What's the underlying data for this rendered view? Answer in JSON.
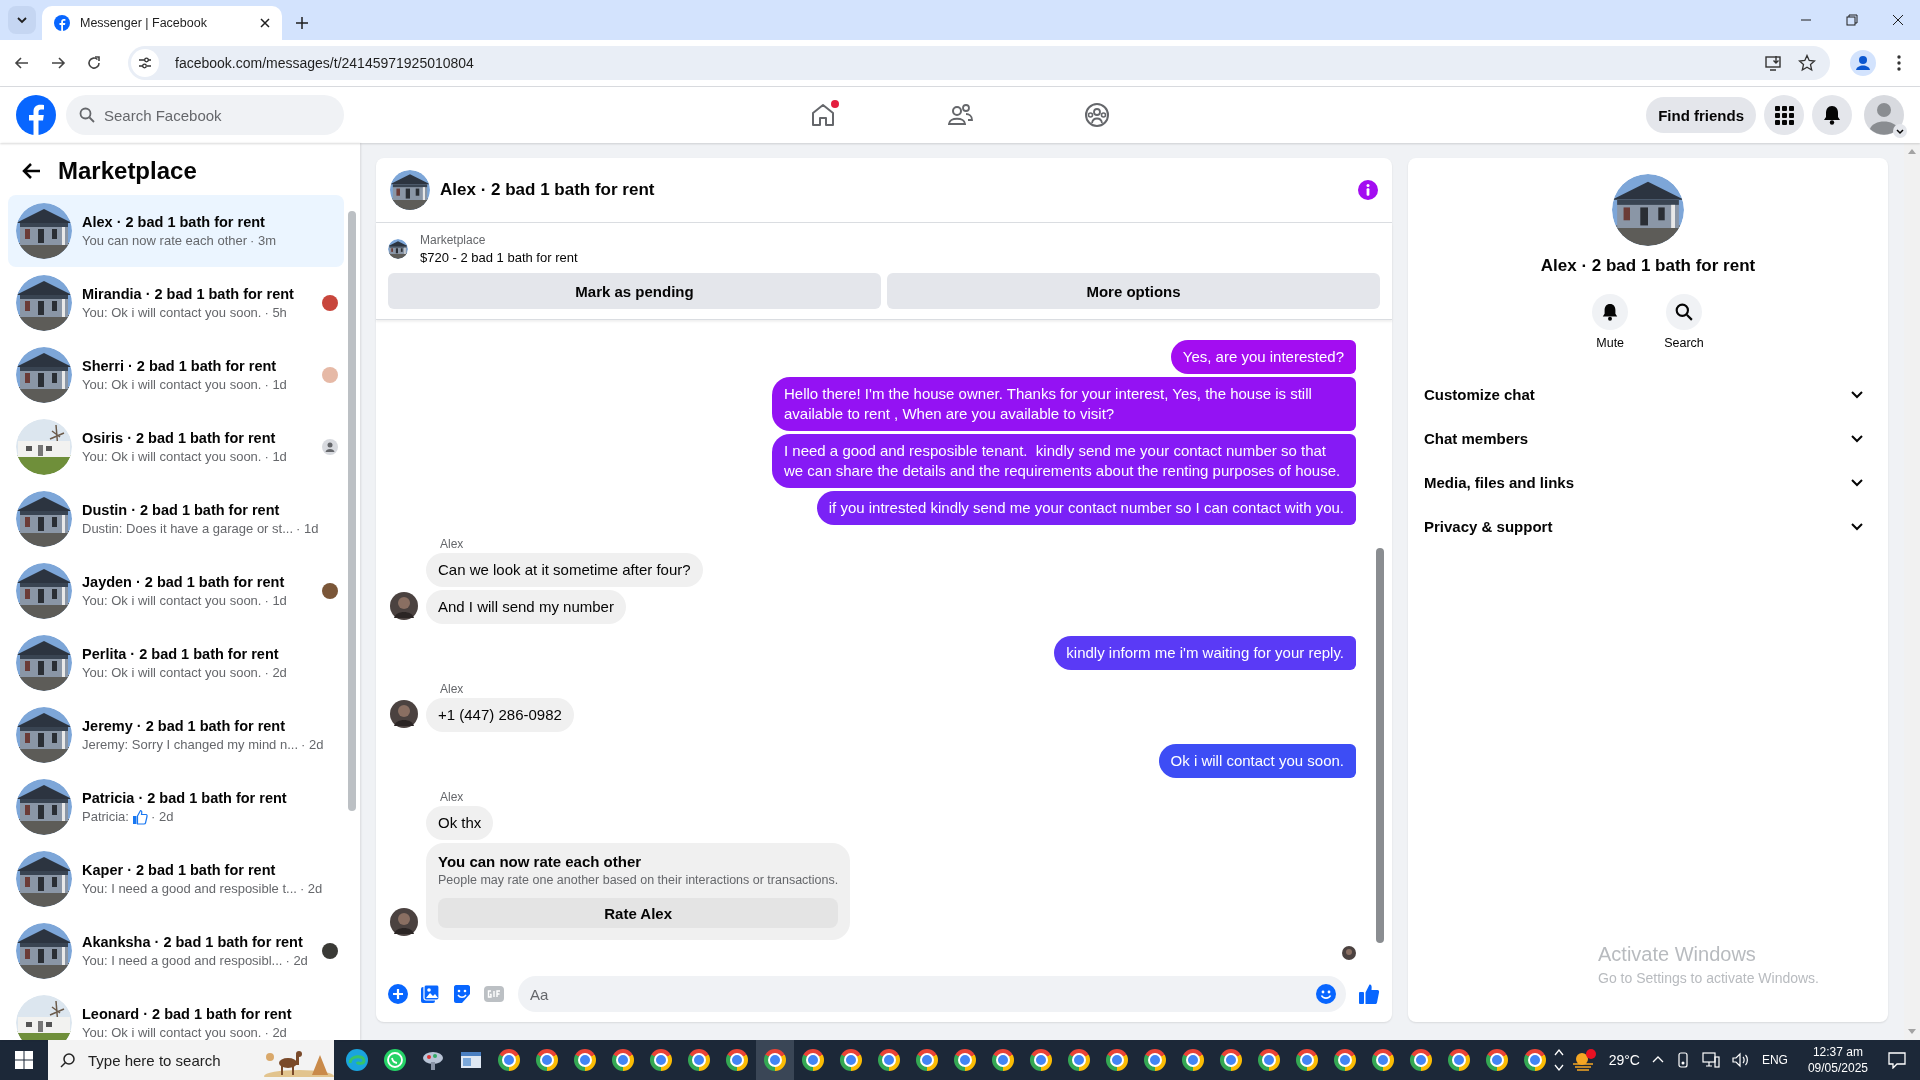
{
  "browser": {
    "tab": {
      "title": "Messenger | Facebook"
    },
    "url": "facebook.com/messages/t/24145971925010804"
  },
  "header": {
    "search": {
      "placeholder": "Search Facebook"
    },
    "nav": [
      {
        "kind": "home",
        "badge": true
      },
      {
        "kind": "friends",
        "badge": false
      },
      {
        "kind": "groups",
        "badge": false
      }
    ],
    "find_friends": "Find friends"
  },
  "sidebar": {
    "title": "Marketplace",
    "conversations": [
      {
        "name": "Alex · 2 bad 1 bath for rent",
        "preview": "You can now rate each other",
        "time": "· 3m",
        "kind": "house",
        "selected": true
      },
      {
        "name": "Mirandia · 2 bad 1 bath for rent",
        "preview": "You: Ok i will contact you soon.",
        "time": "· 5h",
        "kind": "house",
        "selected": false
      },
      {
        "name": "Sherri · 2 bad 1 bath for rent",
        "preview": "You: Ok i will contact you soon.",
        "time": "· 1d",
        "kind": "house",
        "selected": false
      },
      {
        "name": "Osiris · 2 bad 1 bath for rent",
        "preview": "You: Ok i will contact you soon.",
        "time": "· 1d",
        "kind": "cottage",
        "selected": false,
        "seen": {
          "kind": "default",
          "color": "#d8dadf"
        }
      },
      {
        "name": "Dustin · 2 bad 1 bath for rent",
        "preview": "Dustin: Does it have a garage or st...",
        "time": "· 1d",
        "kind": "house",
        "selected": false
      },
      {
        "name": "Jayden · 2 bad 1 bath for rent",
        "preview": "You: Ok i will contact you soon.",
        "time": "· 1d",
        "kind": "house",
        "selected": false
      },
      {
        "name": "Perlita · 2 bad 1 bath for rent",
        "preview": "You: Ok i will contact you soon.",
        "time": "· 2d",
        "kind": "house",
        "selected": false
      },
      {
        "name": "Jeremy · 2 bad 1 bath for rent",
        "preview": "Jeremy: Sorry I changed my mind n...",
        "time": "· 2d",
        "kind": "house",
        "selected": false
      },
      {
        "name": "Patricia · 2 bad 1 bath for rent",
        "preview": "Patricia:",
        "liked": true,
        "time": "· 2d",
        "kind": "house",
        "selected": false
      },
      {
        "name": "Kaper · 2 bad 1 bath for rent",
        "preview": "You: I need a good and resposible t...",
        "time": "· 2d",
        "kind": "house",
        "selected": false
      },
      {
        "name": "Akanksha · 2 bad 1 bath for rent",
        "preview": "You: I need a good and resposibl...",
        "time": "· 2d",
        "kind": "house",
        "selected": false
      },
      {
        "name": "Leonard · 2 bad 1 bath for rent",
        "preview": "You: Ok i will contact you soon.",
        "time": "· 2d",
        "kind": "cottage",
        "selected": false
      }
    ]
  },
  "chat": {
    "title": "Alex · 2 bad 1 bath for rent",
    "listing": {
      "label": "Marketplace",
      "price": "$720 - 2 bad 1 bath for rent"
    },
    "actions": [
      "Mark as pending",
      "More options"
    ],
    "messages": [
      {
        "kind": "out",
        "text": "Yes, are you interested?",
        "color": "#a30df1"
      },
      {
        "kind": "out",
        "text": "Hello there! I'm the house owner. Thanks for your interest, Yes, the house is still available to rent , When are you available to visit?",
        "color": "#9412f3"
      },
      {
        "kind": "out",
        "text": "I need a good and resposible tenant.  kindly send me your contact number so that we can share the details and the requirements about the renting purposes of house.",
        "color": "#861af5"
      },
      {
        "kind": "out",
        "text": "if you intrested kindly send me your contact number so I can contact with you.",
        "color": "#7a22f6"
      },
      {
        "kind": "sender",
        "text": "Alex"
      },
      {
        "kind": "in",
        "text": "Can we look at it sometime after four?",
        "avatar": false
      },
      {
        "kind": "in",
        "text": "And I will send my number",
        "avatar": true
      },
      {
        "kind": "out",
        "text": "kindly inform me i'm waiting for your reply.",
        "color": "#5a3af6"
      },
      {
        "kind": "sender",
        "text": "Alex"
      },
      {
        "kind": "in",
        "text": "+1 (447) 286-0982",
        "avatar": true
      },
      {
        "kind": "out",
        "text": "Ok i will contact you soon.",
        "color": "#3d4df5"
      },
      {
        "kind": "sender",
        "text": "Alex"
      },
      {
        "kind": "in",
        "text": "Ok thx",
        "avatar": false
      },
      {
        "kind": "rating",
        "title": "You can now rate each other",
        "text": "People may rate one another based on their interactions or transactions.",
        "button": "Rate Alex",
        "avatar": true
      }
    ],
    "read_receipt": true,
    "composer": {
      "placeholder": "Aa"
    }
  },
  "details": {
    "title": "Alex · 2 bad 1 bath for rent",
    "actions": [
      {
        "kind": "mute",
        "label": "Mute"
      },
      {
        "kind": "search",
        "label": "Search"
      }
    ],
    "sections": [
      {
        "label": "Customize chat",
        "expanded": false
      },
      {
        "label": "Chat members",
        "expanded": false
      },
      {
        "label": "Media, files and links",
        "expanded": false
      },
      {
        "label": "Privacy & support",
        "expanded": false
      }
    ]
  },
  "activation_notice": {
    "title": "Activate Windows",
    "text": "Go to Settings to activate Windows."
  },
  "taskbar": {
    "search": {
      "placeholder": "Type here to search"
    },
    "apps": [
      {
        "kind": "edge",
        "selected": false
      },
      {
        "kind": "whatsapp",
        "selected": false
      },
      {
        "kind": "app",
        "selected": false
      },
      {
        "kind": "explorer",
        "selected": false
      },
      {
        "kind": "chrome",
        "selected": false
      },
      {
        "kind": "chrome",
        "selected": false
      },
      {
        "kind": "chrome",
        "selected": false
      },
      {
        "kind": "chrome",
        "selected": false
      },
      {
        "kind": "chrome",
        "selected": false
      },
      {
        "kind": "chrome",
        "selected": false
      },
      {
        "kind": "chrome",
        "selected": false
      },
      {
        "kind": "chrome",
        "selected": true
      },
      {
        "kind": "chrome",
        "selected": false
      },
      {
        "kind": "chrome",
        "selected": false
      },
      {
        "kind": "chrome",
        "selected": false
      },
      {
        "kind": "chrome",
        "selected": false
      },
      {
        "kind": "chrome",
        "selected": false
      },
      {
        "kind": "chrome",
        "selected": false
      },
      {
        "kind": "chrome",
        "selected": false
      },
      {
        "kind": "chrome",
        "selected": false
      },
      {
        "kind": "chrome",
        "selected": false
      },
      {
        "kind": "chrome",
        "selected": false
      },
      {
        "kind": "chrome",
        "selected": false
      },
      {
        "kind": "chrome",
        "selected": false
      },
      {
        "kind": "chrome",
        "selected": false
      },
      {
        "kind": "chrome",
        "selected": false
      },
      {
        "kind": "chrome",
        "selected": false
      },
      {
        "kind": "chrome",
        "selected": false
      },
      {
        "kind": "chrome",
        "selected": false
      },
      {
        "kind": "chrome",
        "selected": false
      },
      {
        "kind": "chrome",
        "selected": false
      },
      {
        "kind": "chrome",
        "selected": false
      }
    ],
    "weather": "29°C",
    "language": "ENG",
    "time": "12:37 am",
    "date": "09/05/2025"
  }
}
